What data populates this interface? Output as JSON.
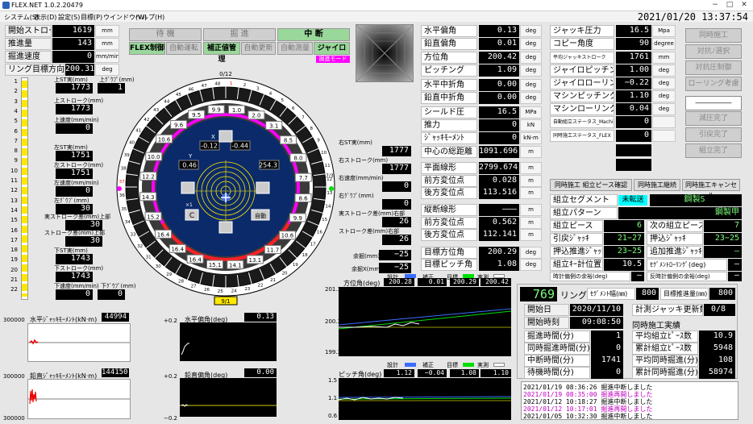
{
  "window": {
    "title": "FLEX.NET 1.0.2.20479",
    "min": "−",
    "max": "□",
    "close": "✕"
  },
  "menu": [
    "システム(S)",
    "表示(D)",
    "設定(S)",
    "目標(P)",
    "ウインドウ(W)",
    "ヘルプ(H)"
  ],
  "datetime": "2021/01/20 13:37:54",
  "left_top": [
    {
      "label": "開始ストローク",
      "value": "1619",
      "unit": "mm"
    },
    {
      "label": "推進量",
      "value": "143",
      "unit": "mm"
    },
    {
      "label": "掘進速度",
      "value": "0",
      "unit": "mm/min"
    },
    {
      "label": "リング目標方向角",
      "value": "200.31",
      "unit": "deg"
    }
  ],
  "modes": {
    "row1": [
      "待 機",
      "掘 進",
      "中 断"
    ],
    "row2": [
      "FLEX制御",
      "自動運転",
      "補正値管理",
      "自動更新",
      "自動測量",
      "ジャイロ"
    ]
  },
  "excavation_mode": "掘進モード",
  "bar_scale": [
    "1",
    "2",
    "3",
    "4",
    "5",
    "6",
    "7",
    "8",
    "9",
    "10",
    "11",
    "12",
    "13",
    "14",
    "15",
    "16",
    "17",
    "18",
    "19",
    "20",
    "21",
    "22"
  ],
  "strokes": [
    {
      "label": "上ST実(mm)",
      "value": "1773"
    },
    {
      "label": "上ｸﾞｳﾌﾟ(mm)",
      "value": "1"
    },
    {
      "label": "上ストローク(mm)",
      "value": "1773"
    },
    {
      "label": "上速度(mm/min)",
      "value": "0"
    },
    {
      "label": "左ST実(mm)",
      "value": "1751"
    },
    {
      "label": "左ストローク(mm)",
      "value": "1751"
    },
    {
      "label": "左速度(mm/min)",
      "value": "0"
    },
    {
      "label": "左ｸﾞｳﾌﾟ(mm)",
      "value": "30"
    },
    {
      "label": "実ストローク差(mm)上部",
      "value": "30"
    },
    {
      "label": "ストローク差(mm)上部",
      "value": "30"
    },
    {
      "label": "下ST実(mm)",
      "value": "1743"
    },
    {
      "label": "下ストローク(mm)",
      "value": "1743"
    },
    {
      "label": "下速度(mm/min)",
      "value": "0"
    },
    {
      "label": "下ｸﾞｳﾌﾟ(mm)",
      "value": "0"
    }
  ],
  "right_strokes": [
    {
      "label": "右ST実(mm)",
      "value": "1777"
    },
    {
      "label": "右ストローク(mm)",
      "value": "1777"
    },
    {
      "label": "右速度(mm/min)",
      "value": "0"
    },
    {
      "label": "右ｸﾞｳﾌﾟ(mm)",
      "value": "0"
    },
    {
      "label": "実ストローク差(mm)右部",
      "value": "26"
    },
    {
      "label": "ストローク差(mm)右部",
      "value": "26"
    }
  ],
  "margins": [
    {
      "label": "余掘(mm)",
      "value": "−25"
    },
    {
      "label": "余掘X(mm)",
      "value": "−25"
    }
  ],
  "dial": {
    "top": "0/12",
    "bottom": "9/1",
    "left": "37",
    "right": "7/3",
    "center": {
      "x_label": "X",
      "y_label": "Y",
      "x1": "-0.12",
      "x2": "-0.44",
      "y1": "0.46",
      "y2": "254.3",
      "btn_c": "C",
      "btn_auto": "自動",
      "x_mult": "×1"
    },
    "outer_nums": [
      "1",
      "2",
      "3",
      "4",
      "5",
      "6",
      "7",
      "8",
      "9",
      "10",
      "11",
      "12",
      "13",
      "14",
      "15",
      "16",
      "17",
      "18",
      "19",
      "20",
      "21",
      "22",
      "23",
      "24",
      "25",
      "26",
      "27",
      "28",
      "29",
      "30",
      "31",
      "32",
      "33",
      "34",
      "35",
      "36",
      "37",
      "38",
      "39",
      "40",
      "41",
      "42",
      "43",
      "44",
      "45",
      "46",
      "47",
      "48"
    ],
    "inner_nums": [
      "1.0",
      "2.0",
      "3.1",
      "8.5",
      "8.0",
      "7.7",
      "8.6",
      "9.9",
      "10.6",
      "11.7",
      "13.1",
      "14.1",
      "15.1",
      "16.4",
      "16.4",
      "16.4",
      "15.2",
      "14.3",
      "12.2",
      "10.0",
      "10.6",
      "9.6",
      "9.5",
      "9.9"
    ]
  },
  "nav": [
    {
      "label": "水平偏角",
      "value": "0.13",
      "unit": "deg"
    },
    {
      "label": "鉛直偏角",
      "value": "0.01",
      "unit": "deg"
    },
    {
      "label": "方位角",
      "value": "200.42",
      "unit": "deg"
    },
    {
      "label": "ピッチング",
      "value": "1.09",
      "unit": "deg"
    },
    {
      "label": "水平中折角",
      "value": "0.00",
      "unit": "deg"
    },
    {
      "label": "鉛直中折角",
      "value": "0.00",
      "unit": "deg"
    },
    {
      "label": "シールド圧",
      "value": "16.5",
      "unit": "MPa"
    },
    {
      "label": "推力",
      "value": "0",
      "unit": "kN"
    },
    {
      "label": "ｼﾞｬｯｷﾓｰﾒﾝﾄ",
      "value": "0",
      "unit": "kN-m"
    }
  ],
  "dist": [
    {
      "label": "中心の総距離",
      "value": "1091.696",
      "unit": "m"
    },
    {
      "label": "平面線形",
      "value": "2799.674",
      "unit": "m"
    },
    {
      "label": "前方変位点",
      "value": "0.028",
      "unit": "m"
    },
    {
      "label": "後方変位点",
      "value": "113.516",
      "unit": "m"
    },
    {
      "label": "縦断線形",
      "value": "―――",
      "unit": "m"
    },
    {
      "label": "前方変位点",
      "value": "0.562",
      "unit": "m"
    },
    {
      "label": "後方変位点",
      "value": "112.141",
      "unit": "m"
    },
    {
      "label": "目標方位角",
      "value": "200.29",
      "unit": "deg"
    },
    {
      "label": "目標ピッチ角",
      "value": "1.08",
      "unit": "deg"
    }
  ],
  "jack": [
    {
      "label": "ジャッキ圧力",
      "value": "16.5",
      "unit": "Mpa"
    },
    {
      "label": "コピー角度",
      "value": "90",
      "unit": "degree"
    },
    {
      "label": "平均ジャッキストローク",
      "value": "1761",
      "unit": "mm"
    },
    {
      "label": "ジャイロピッチング",
      "value": "1.00",
      "unit": "deg"
    },
    {
      "label": "ジャイロローリング",
      "value": "−0.22",
      "unit": "deg"
    },
    {
      "label": "マシンピッチング",
      "value": "1.10",
      "unit": "deg"
    },
    {
      "label": "マシンローリング",
      "value": "0.04",
      "unit": "deg"
    },
    {
      "label": "自動組立ステータス_Machine",
      "value": "0",
      "unit": ""
    },
    {
      "label": "同時施工ステータス_FLEX",
      "value": "0",
      "unit": ""
    }
  ],
  "side_buttons": [
    "同時施工",
    "対抗ﾉ選択",
    "対抗圧制御",
    "ローリング考慮",
    "―――――",
    "減圧完了",
    "引戻完了",
    "組立完了"
  ],
  "seg_buttons": [
    "同時施工 組立ピース確認",
    "同時施工継続",
    "同時施工キャンセル"
  ],
  "seg": {
    "segment_label": "組立セグメント",
    "segment_state": "未転送",
    "segment_type": "鋼製S",
    "pattern_label": "組立パターン",
    "pattern": "鋼製甲",
    "piece_label": "組立ピース",
    "piece": "6",
    "next_label": "次の組立ピース",
    "next": "7",
    "pull_label": "引戻ｼﾞｬｯｷ",
    "pull": "21−27",
    "push_label": "押込ｼﾞｬｯｷ",
    "push": "23−25",
    "ppush_label": "押込推進ｼﾞｬｯｷ",
    "ppush": "23−25",
    "add_label": "追加推進ｼﾞｬｯｷ",
    "add": "―",
    "kpos_label": "組立ｷｰ計位置",
    "kpos": "10.5",
    "roll_label": "ｾｸﾞﾒﾝﾄﾛｰﾘﾝｸﾞ(deg)",
    "roll": "―",
    "clock_label": "時計偏側の余裕(deg)",
    "clock": "―",
    "cclock_label": "反時計偏側の余裕(deg)",
    "cclock": "―"
  },
  "ring": {
    "number": "769",
    "label": "リング",
    "seg_w_label": "ｾｸﾞﾒﾝﾄ幅(㎜)",
    "seg_w": "800",
    "target_label": "目標推進量(㎜)",
    "target": "800",
    "start_label": "開始日",
    "start": "2020/11/10",
    "update_label": "計測ジャッキ更新数",
    "update": "0/8",
    "time_label": "開始時刻",
    "time": "09:08:50",
    "sim_label": "同時施工実績",
    "rows": [
      {
        "l": "掘進時間(分)",
        "v": "1",
        "r": "平均組立ﾋﾟｰｽ数",
        "rv": "10.9"
      },
      {
        "l": "同時掘進時間(分)",
        "v": "0",
        "r": "累計組立ﾋﾟｰｽ数",
        "rv": "5948"
      },
      {
        "l": "中断時間(分)",
        "v": "1741",
        "r": "平均同時掘進(分)",
        "rv": "108"
      },
      {
        "l": "待機時間(分)",
        "v": "0",
        "r": "累計同時掘進(分)",
        "rv": "58974"
      }
    ]
  },
  "log": [
    {
      "t": "2021/01/19 08:36:26",
      "m": "掘進中断しました",
      "c": "#000"
    },
    {
      "t": "2021/01/19 08:35:00",
      "m": "掘進再開しました",
      "c": "#c000c0"
    },
    {
      "t": "2021/01/12 10:18:27",
      "m": "掘進中断しました",
      "c": "#000"
    },
    {
      "t": "2021/01/12 10:17:01",
      "m": "掘進再開しました",
      "c": "#c000c0"
    },
    {
      "t": "2021/01/05 10:32:30",
      "m": "掘進中断しました",
      "c": "#000"
    }
  ],
  "graphs": {
    "hmoment": {
      "title": "水平ｼﾞｬｯｷﾓｰﾒﾝﾄ(kN·m)",
      "value": "44994",
      "top": "300000",
      "bottom": "300000"
    },
    "vmoment": {
      "title": "鉛直ｼﾞｬｯｷﾓｰﾒﾝﾄ(kN·m)",
      "value": "144150",
      "top": "300000",
      "bottom": "300000"
    },
    "hdev": {
      "title": "水平偏角(deg)",
      "value": "0.13",
      "top": "+0.2",
      "bottom": "−0.2"
    },
    "vdev": {
      "title": "鉛直偏角(deg)",
      "value": "0.00",
      "top": "+0.2",
      "bottom": "−0.2"
    },
    "azimuth": {
      "title": "方位角(deg)",
      "legend": [
        "設計",
        "補正",
        "目標",
        "実測"
      ],
      "vals": [
        "200.28",
        "0.01",
        "200.29",
        "200.42"
      ],
      "ymax": "201.3",
      "ymid": "200.3",
      "ymin": "199.3"
    },
    "pitch": {
      "title": "ピッチ角(deg)",
      "legend": [
        "設計",
        "補正",
        "目標",
        "実測"
      ],
      "vals": [
        "1.12",
        "−0.04",
        "1.08",
        "1.10"
      ],
      "ymax": "1.5",
      "ymid": "1.1",
      "ymin": "0.6"
    }
  },
  "colors": {
    "green": "#9ad79a",
    "red": "#ff2020",
    "magenta": "#ff00ff",
    "navy": "#0a2a6a",
    "yellow": "#ffea00",
    "blue": "#3c6cff"
  }
}
